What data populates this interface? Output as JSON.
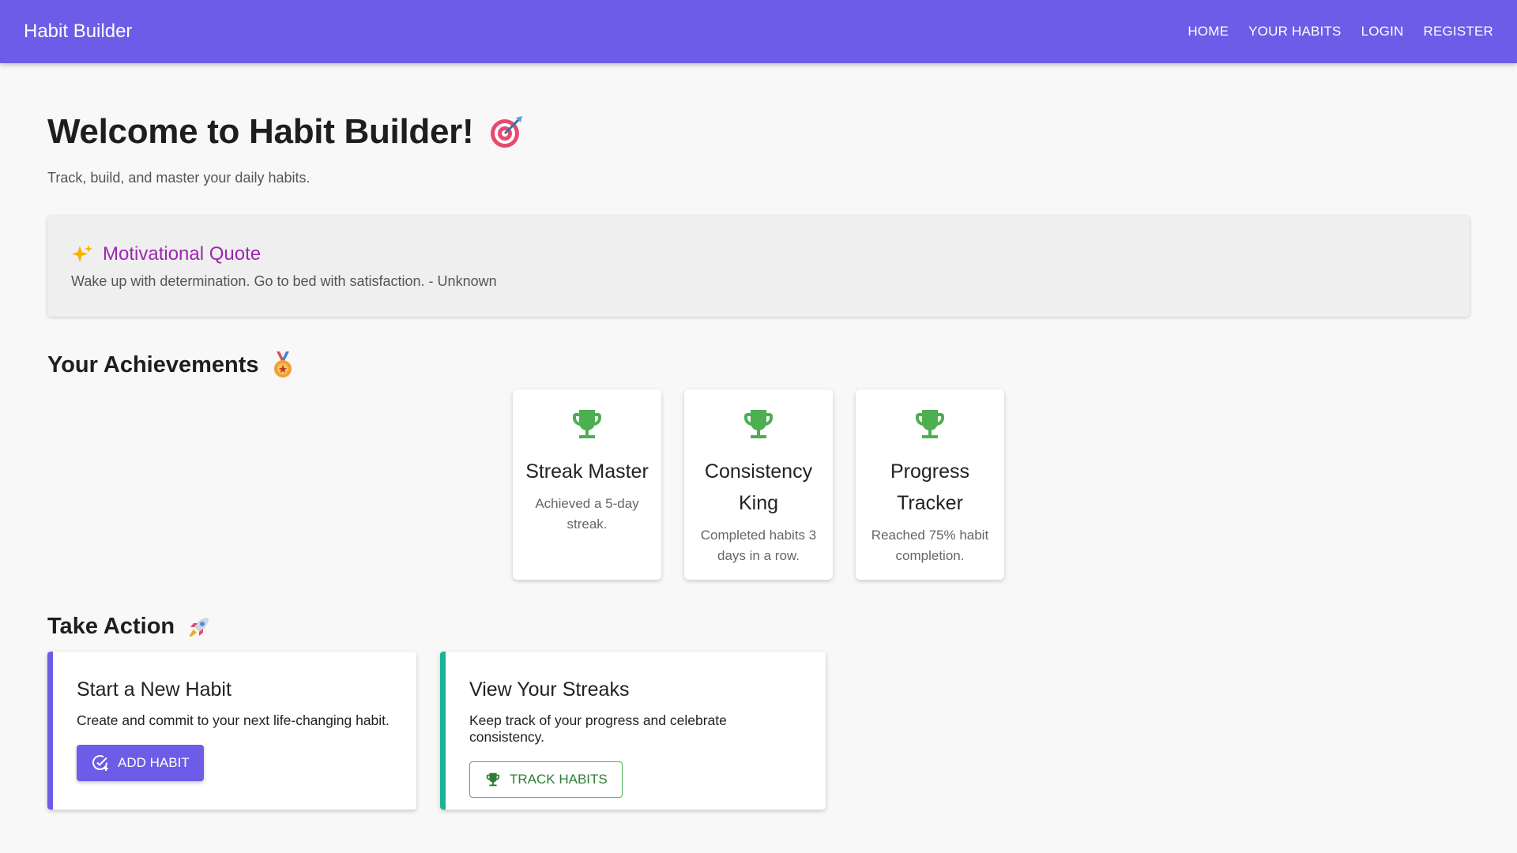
{
  "navbar": {
    "brand": "Habit Builder",
    "links": [
      "HOME",
      "YOUR HABITS",
      "LOGIN",
      "REGISTER"
    ],
    "color": "#6c5ce7"
  },
  "hero": {
    "title": "Welcome to Habit Builder!",
    "title_icon": "target-icon",
    "subtitle": "Track, build, and master your daily habits."
  },
  "quote": {
    "icon": "sparkles-icon",
    "title": "Motivational Quote",
    "text": "Wake up with determination. Go to bed with satisfaction. - Unknown",
    "title_color": "#9c27b0"
  },
  "achievements": {
    "title": "Your Achievements",
    "title_icon": "medal-icon",
    "items": [
      {
        "icon": "trophy-icon",
        "title": "Streak Master",
        "desc": "Achieved a 5-day streak."
      },
      {
        "icon": "trophy-icon",
        "title": "Consistency King",
        "desc": "Completed habits 3 days in a row."
      },
      {
        "icon": "trophy-icon",
        "title": "Progress Tracker",
        "desc": "Reached 75% habit completion."
      }
    ],
    "icon_color": "#4caf50"
  },
  "actions": {
    "title": "Take Action",
    "title_icon": "rocket-icon",
    "cards": [
      {
        "title": "Start a New Habit",
        "desc": "Create and commit to your next life-changing habit.",
        "button": "ADD HABIT",
        "button_icon": "add-task-icon",
        "accent": "#6c5ce7"
      },
      {
        "title": "View Your Streaks",
        "desc": "Keep track of your progress and celebrate consistency.",
        "button": "TRACK HABITS",
        "button_icon": "trophy-icon",
        "accent": "#1ab394"
      }
    ]
  }
}
